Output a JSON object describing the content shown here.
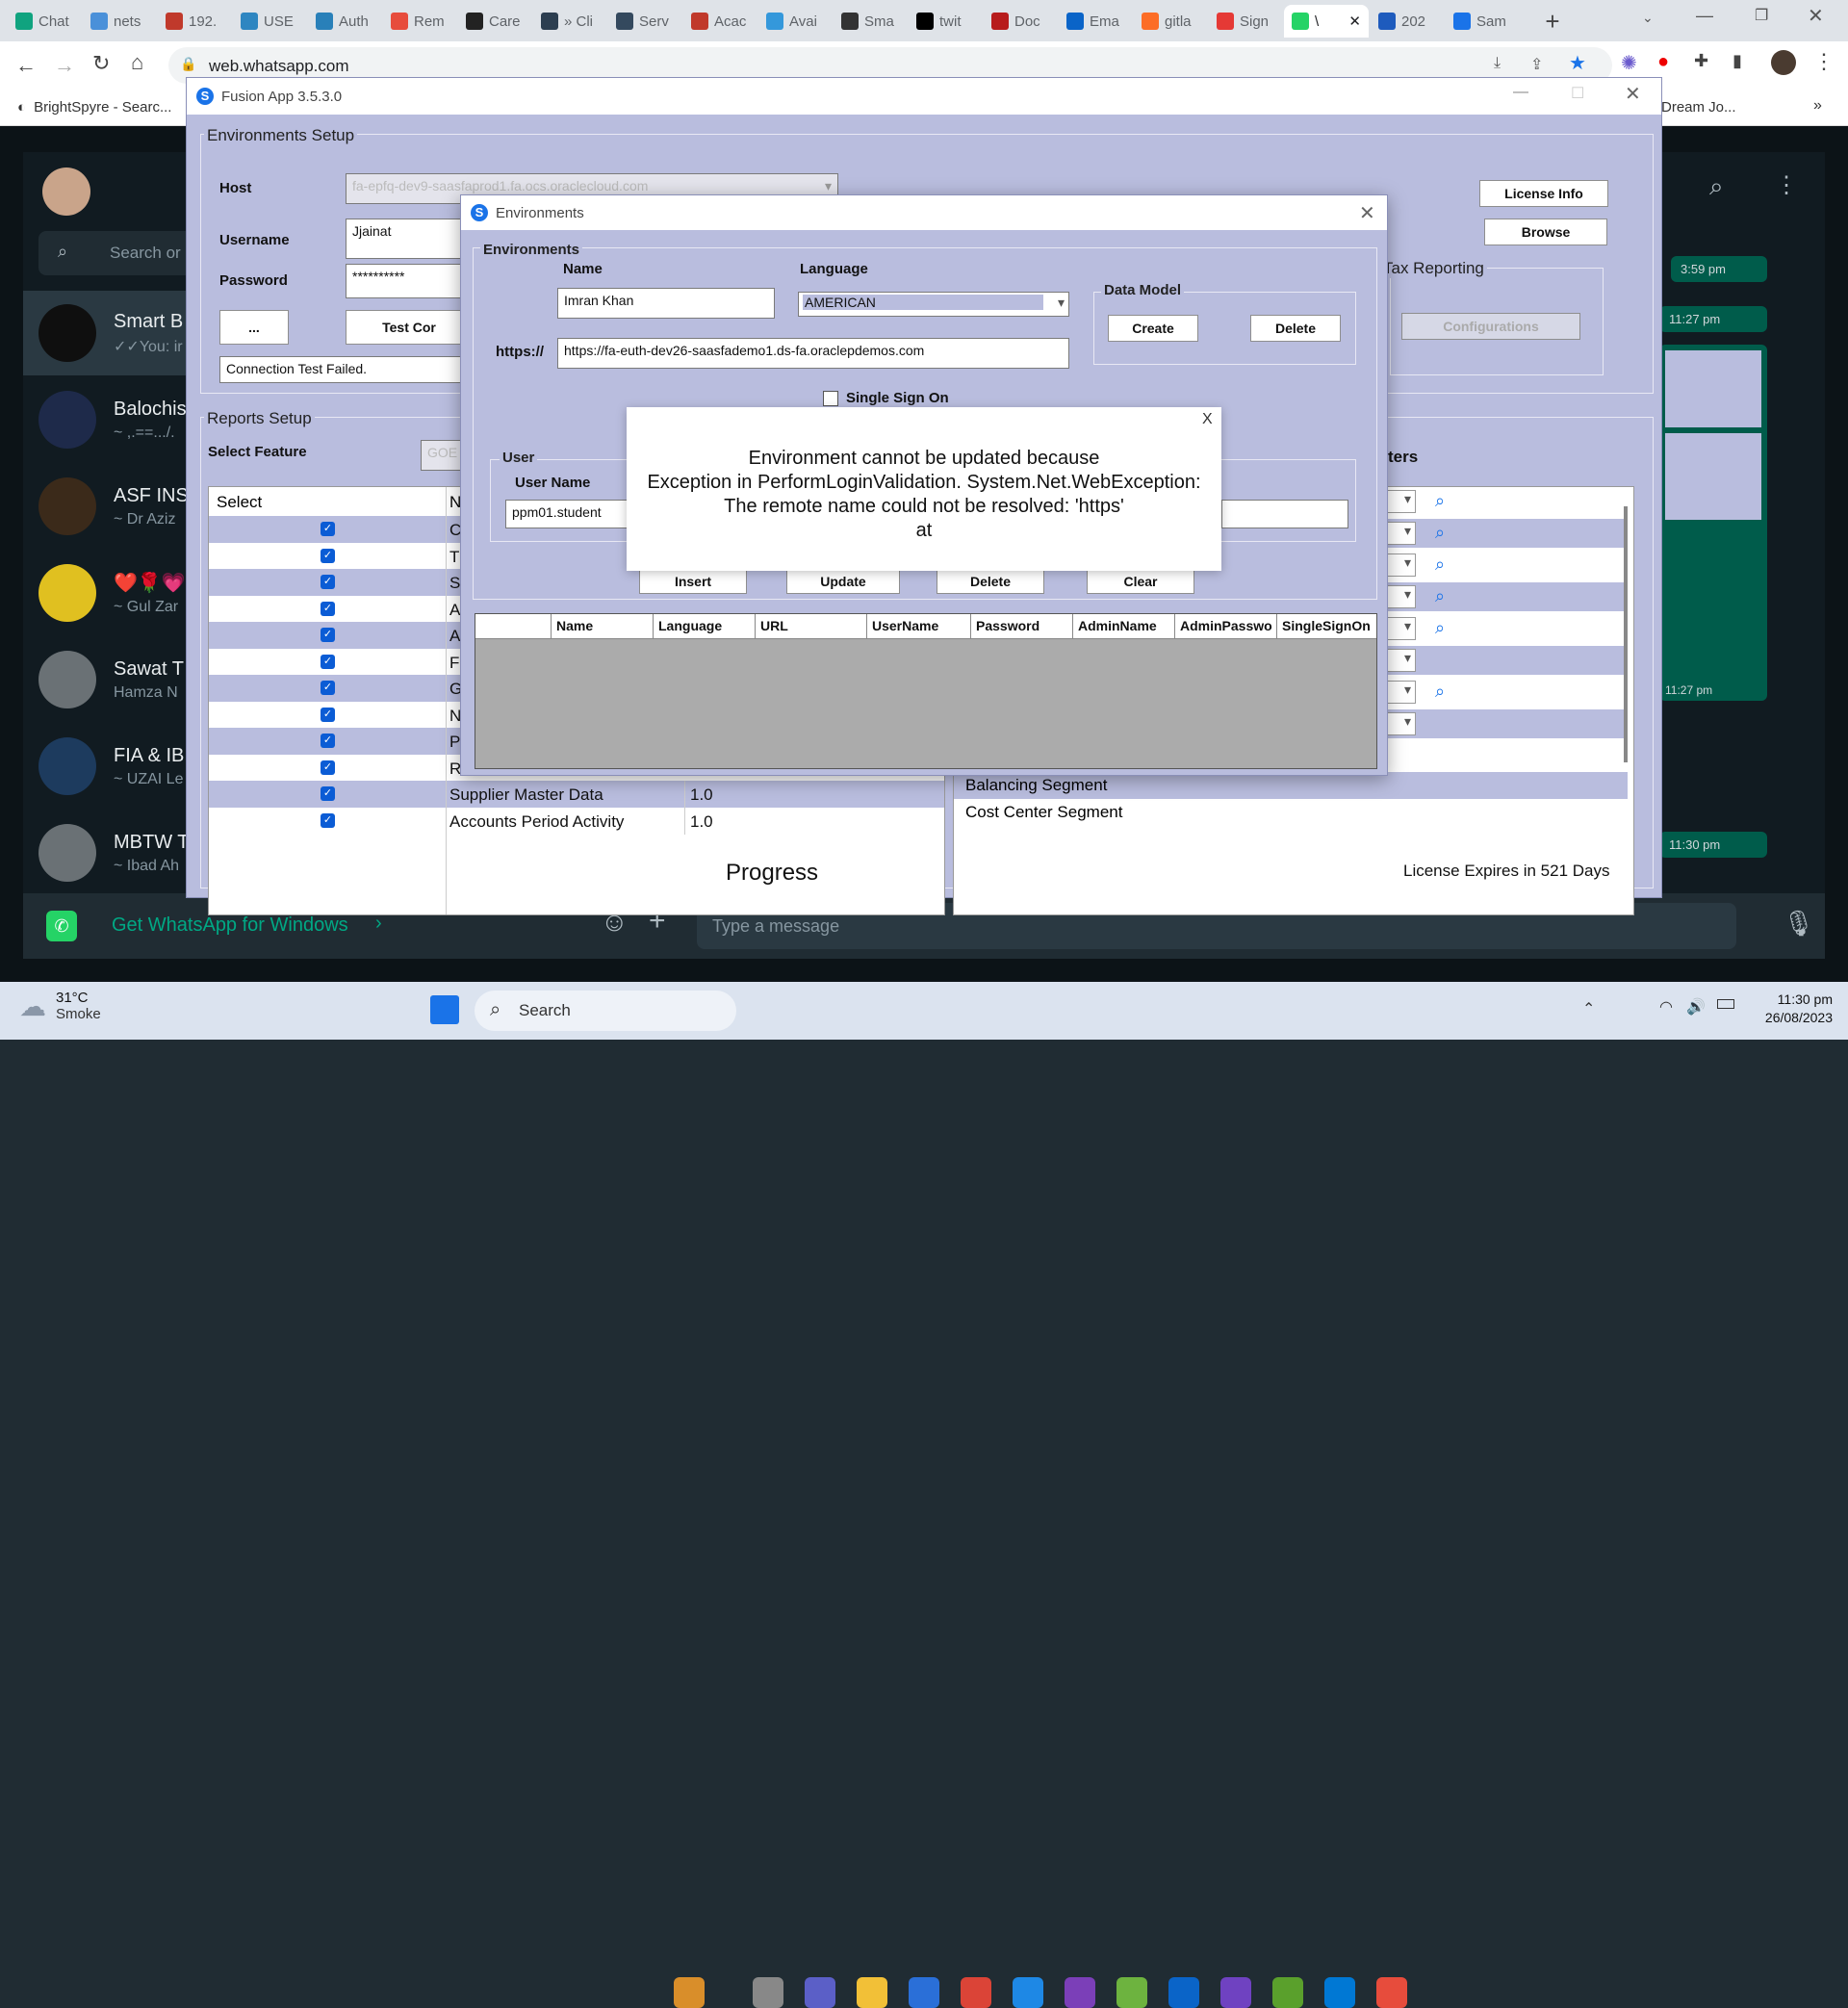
{
  "browser": {
    "tabs": [
      {
        "label": "Chat",
        "color": "#10a37f"
      },
      {
        "label": "nets",
        "color": "#4a90d9"
      },
      {
        "label": "192.",
        "color": "#c0392b"
      },
      {
        "label": "USE",
        "color": "#2e86c1"
      },
      {
        "label": "Auth",
        "color": "#2980b9"
      },
      {
        "label": "Rem",
        "color": "#e74c3c"
      },
      {
        "label": "Care",
        "color": "#222222"
      },
      {
        "label": "» Cli",
        "color": "#2c3e50"
      },
      {
        "label": "Serv",
        "color": "#34495e"
      },
      {
        "label": "Acac",
        "color": "#c0392b"
      },
      {
        "label": "Avai",
        "color": "#3498db"
      },
      {
        "label": "Sma",
        "color": "#333333"
      },
      {
        "label": "twit",
        "color": "#000000"
      },
      {
        "label": "Doc",
        "color": "#b71c1c"
      },
      {
        "label": "Ema",
        "color": "#0a64c8"
      },
      {
        "label": "gitla",
        "color": "#fc6d26"
      },
      {
        "label": "Sign",
        "color": "#e53935"
      },
      {
        "label": "\\",
        "color": "#25d366"
      },
      {
        "label": "202",
        "color": "#1e5bbd"
      },
      {
        "label": "Sam",
        "color": "#1a73e8"
      }
    ],
    "url": "web.whatsapp.com",
    "bookmarks": [
      "BrightSpyre - Searc...",
      "Dream Jo..."
    ]
  },
  "whatsapp": {
    "search_placeholder": "Search or",
    "chats": [
      {
        "name": "Smart B",
        "preview": "✓✓You: ir"
      },
      {
        "name": "Balochis",
        "preview": "~ ,.==.../."
      },
      {
        "name": "ASF INS",
        "preview": "~ Dr Aziz"
      },
      {
        "name": "❤️🌹💗",
        "preview": "~ Gul Zar"
      },
      {
        "name": "Sawat T",
        "preview": "Hamza N"
      },
      {
        "name": "FIA & IB",
        "preview": "~ UZAI Le"
      },
      {
        "name": "MBTW T",
        "preview": "~ Ibad Ah"
      }
    ],
    "get_app": "Get WhatsApp for Windows",
    "message_placeholder": "Type a message",
    "times": [
      "3:59 pm",
      "11:27 pm",
      "11:27 pm",
      "11:30 pm"
    ]
  },
  "fusion": {
    "title": "Fusion App 3.5.3.0",
    "env_setup": {
      "label": "Environments Setup",
      "host_label": "Host",
      "host_value": "fa-epfq-dev9-saasfaprod1.fa.ocs.oraclecloud.com",
      "username_label": "Username",
      "username_value": "Jjainat",
      "password_label": "Password",
      "password_value": "**********",
      "dots_btn": "...",
      "test_btn": "Test Cor",
      "status": "Connection Test Failed."
    },
    "license_btn": "License Info",
    "browse_btn": "Browse",
    "tax_label": "Tax Reporting",
    "config_btn": "Configurations",
    "reports": {
      "label": "Reports Setup",
      "select_feature": "Select Feature",
      "feature_placeholder": "GOE",
      "col_select": "Select",
      "col_n": "N",
      "rows": [
        {
          "initial": "C"
        },
        {
          "initial": "T"
        },
        {
          "initial": "S"
        },
        {
          "initial": "A"
        },
        {
          "initial": "A"
        },
        {
          "initial": "F"
        },
        {
          "initial": "G"
        },
        {
          "initial": "N"
        },
        {
          "initial": "P"
        },
        {
          "initial": "R"
        }
      ],
      "full_rows": [
        {
          "name": "Supplier Master Data",
          "version": "1.0"
        },
        {
          "name": "Accounts Period Activity",
          "version": "1.0"
        }
      ]
    },
    "params_header": "ters",
    "segments": [
      "Balancing Segment",
      "Cost Center Segment"
    ],
    "progress": "Progress",
    "license_expiry": "License Expires in 521 Days"
  },
  "env_dialog": {
    "title": "Environments",
    "group": "Environments",
    "name_label": "Name",
    "name_value": "Imran Khan",
    "language_label": "Language",
    "language_value": "AMERICAN",
    "https_label": "https://",
    "url_value": "https://fa-euth-dev26-saasfademo1.ds-fa.oraclepdemos.com",
    "data_model": "Data Model",
    "create_btn": "Create",
    "delete_dm_btn": "Delete",
    "sso_label": "Single Sign On",
    "user_group": "User",
    "username_label": "User Name",
    "username_value": "ppm01.student",
    "insert_btn": "Insert",
    "update_btn": "Update",
    "delete_btn": "Delete",
    "clear_btn": "Clear",
    "grid_cols": [
      "Name",
      "Language",
      "URL",
      "UserName",
      "Password",
      "AdminName",
      "AdminPasswo",
      "SingleSignOn"
    ]
  },
  "error_box": {
    "close": "X",
    "lines": [
      "Environment cannot be updated because",
      "Exception in PerformLoginValidation. System.Net.WebException:",
      "The remote name could not be resolved: 'https'",
      "at"
    ]
  },
  "taskbar": {
    "temp": "31°C",
    "weather": "Smoke",
    "search": "Search",
    "time": "11:30 pm",
    "date": "26/08/2023"
  }
}
